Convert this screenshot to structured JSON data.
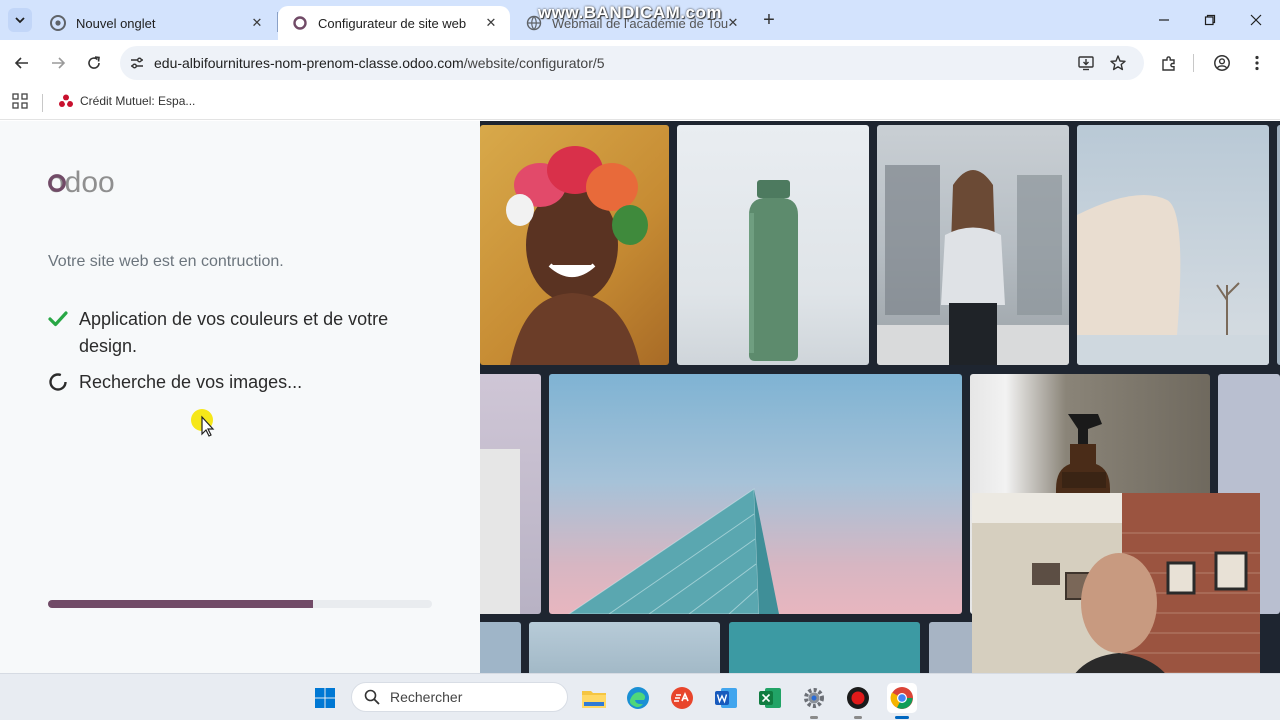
{
  "browser": {
    "tabs": [
      {
        "title": "Nouvel onglet"
      },
      {
        "title": "Configurateur de site web"
      },
      {
        "title": "Webmail de l'académie de Tou"
      }
    ],
    "close_glyph": "✕",
    "new_tab_glyph": "+",
    "url_host": "edu-albifournitures-nom-prenom-classe.odoo.com",
    "url_path": "/website/configurator/5",
    "bookmark": "Crédit Mutuel: Espa...",
    "watermark": "www.BANDICAM.com"
  },
  "page": {
    "logo_text": "odoo",
    "intro": "Votre site web est en contruction.",
    "steps": [
      {
        "label": "Application de vos couleurs et de votre design.",
        "status": "done"
      },
      {
        "label": "Recherche de vos images...",
        "status": "loading"
      }
    ],
    "progress_fraction": 0.69,
    "brand_color": "#714b67"
  },
  "taskbar": {
    "search_placeholder": "Rechercher",
    "apps": [
      "start-icon",
      "file-explorer-icon",
      "edge-icon",
      "ea-icon",
      "word-icon",
      "excel-icon",
      "settings-icon",
      "bandicam-icon",
      "chrome-icon"
    ]
  }
}
